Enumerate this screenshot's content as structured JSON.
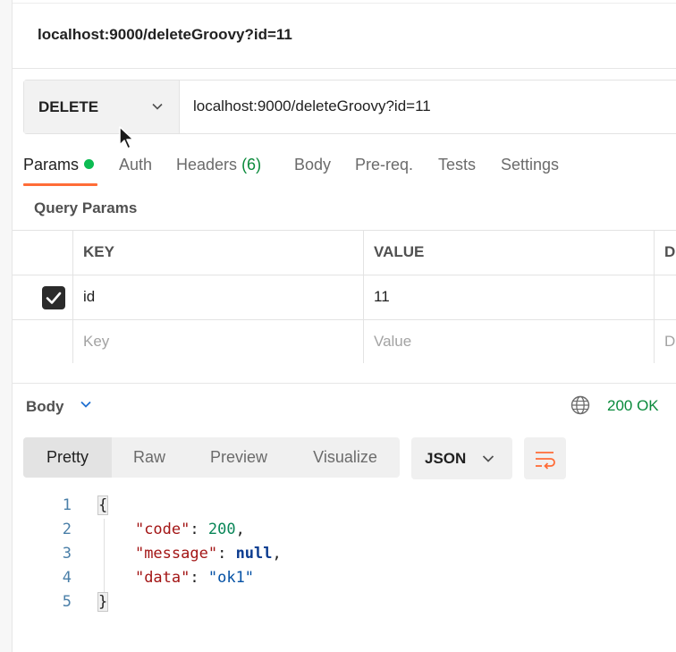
{
  "title": "localhost:9000/deleteGroovy?id=11",
  "request": {
    "method": "DELETE",
    "url": "localhost:9000/deleteGroovy?id=11"
  },
  "tabs": [
    {
      "label": "Params"
    },
    {
      "label": "Auth"
    },
    {
      "label": "Headers",
      "count": "(6)"
    },
    {
      "label": "Body"
    },
    {
      "label": "Pre-req."
    },
    {
      "label": "Tests"
    },
    {
      "label": "Settings"
    }
  ],
  "params": {
    "section_title": "Query Params",
    "columns": [
      "KEY",
      "VALUE",
      "D"
    ],
    "rows": [
      {
        "checked": true,
        "key": "id",
        "value": "11"
      }
    ],
    "placeholder": {
      "key": "Key",
      "value": "Value",
      "desc": "D"
    }
  },
  "response": {
    "body_label": "Body",
    "status": "200 OK",
    "status_color": "#0a8a3b",
    "view_modes": [
      "Pretty",
      "Raw",
      "Preview",
      "Visualize"
    ],
    "format": "JSON",
    "lines": [
      {
        "num": "1",
        "open": "{"
      },
      {
        "num": "2",
        "key": "\"code\"",
        "sep": ": ",
        "val": "200",
        "tail": ","
      },
      {
        "num": "3",
        "key": "\"message\"",
        "sep": ": ",
        "val": "null",
        "tail": ","
      },
      {
        "num": "4",
        "key": "\"data\"",
        "sep": ": ",
        "val": "\"ok1\"",
        "tail": ""
      },
      {
        "num": "5",
        "close": "}"
      }
    ]
  },
  "colors": {
    "accent": "#ff6c37",
    "success": "#0cbb52"
  }
}
